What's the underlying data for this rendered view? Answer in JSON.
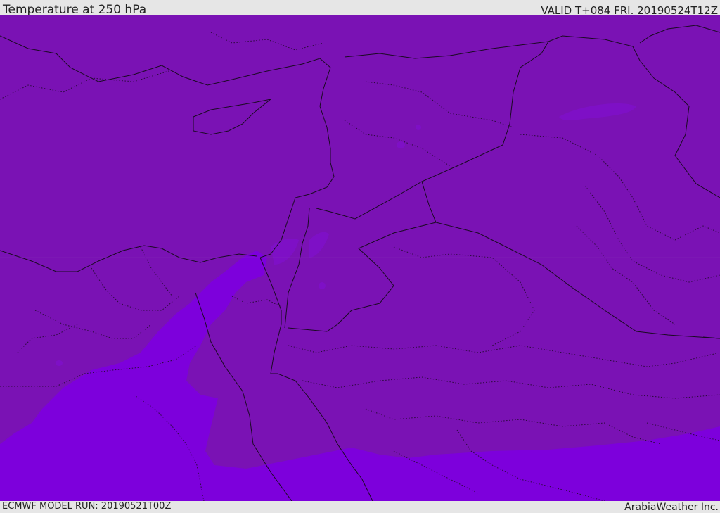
{
  "header": {
    "title": "Temperature at 250 hPa",
    "valid": "VALID T+084 FRI. 20190524T12Z"
  },
  "footer": {
    "model_run": "ECMWF MODEL RUN: 20190521T00Z",
    "credit": "ArabiaWeather Inc."
  },
  "map": {
    "colors": {
      "base_fill": "#7a12b4",
      "warm_fill": "#7d00dc",
      "patch_fill": "#7e10c6",
      "border_line": "#1a0a22",
      "admin_line": "#2a0a3a"
    }
  }
}
